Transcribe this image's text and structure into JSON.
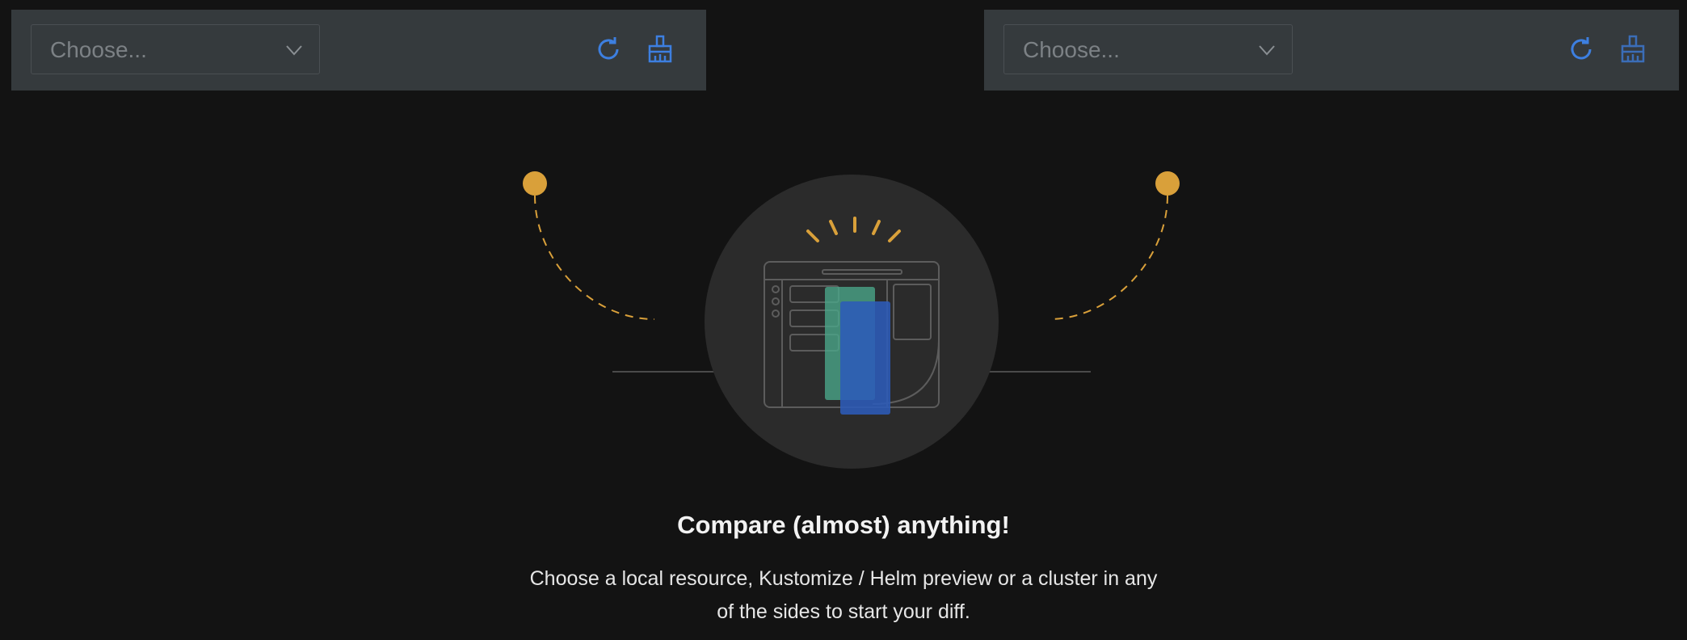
{
  "left_panel": {
    "select_placeholder": "Choose...",
    "refresh_icon": "refresh-icon",
    "clean_icon": "broom-icon"
  },
  "right_panel": {
    "select_placeholder": "Choose...",
    "refresh_icon": "refresh-icon",
    "clean_icon": "broom-icon"
  },
  "empty_state": {
    "title": "Compare (almost) anything!",
    "description": "Choose a local resource, Kustomize / Helm preview or a cluster in any of the sides to start your diff."
  },
  "colors": {
    "background": "#131313",
    "panel": "#353a3d",
    "accent_blue": "#3d7fe0",
    "accent_gold": "#d9a03a",
    "card_green": "#4aa88a",
    "card_blue": "#2c5bb8"
  }
}
